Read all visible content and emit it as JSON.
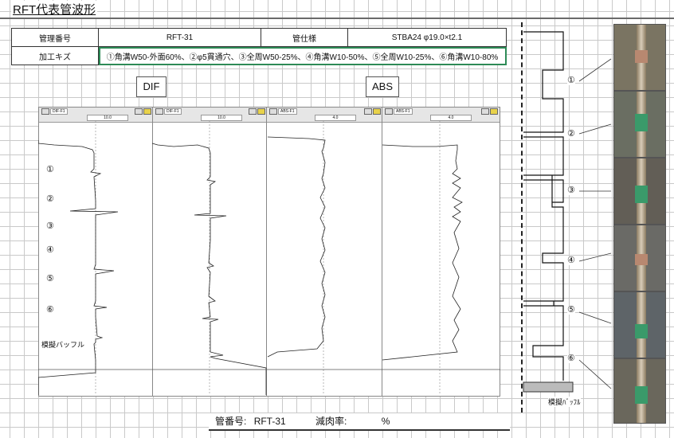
{
  "title": "RFT代表管波形",
  "info_table": {
    "row1": {
      "label1": "管理番号",
      "value1": "RFT-31",
      "label2": "管仕様",
      "value2": "STBA24 φ19.0×t2.1"
    },
    "row2": {
      "label": "加工キズ",
      "value": "①角溝W50-外面60%、②φ5貫通穴、③全周W50-25%、④角溝W10-50%、⑤全周W10-25%、⑥角溝W10-80%"
    }
  },
  "section_labels": {
    "dif": "DIF",
    "abs": "ABS"
  },
  "panels": [
    {
      "name": "DIF-F1",
      "range": "10.0"
    },
    {
      "name": "DIF-F1",
      "range": "10.0"
    },
    {
      "name": "ABS-F1",
      "range": "4.0"
    },
    {
      "name": "ABS-F1",
      "range": "4.0"
    }
  ],
  "defect_markers": [
    "①",
    "②",
    "③",
    "④",
    "⑤",
    "⑥"
  ],
  "baffle_label": "模擬バッフル",
  "diagram": {
    "markers": [
      "①",
      "②",
      "③",
      "④",
      "⑤",
      "⑥"
    ],
    "baffle_label": "模擬ﾊﾞｯﾌﾙ"
  },
  "bottom_bar": {
    "tube_no_label": "管番号:",
    "tube_no_value": "RFT-31",
    "thinning_label": "減肉率:",
    "thinning_unit": "%"
  },
  "colors": {
    "accent": "#2e8b57",
    "pipe_band": "#3a9a6a"
  }
}
